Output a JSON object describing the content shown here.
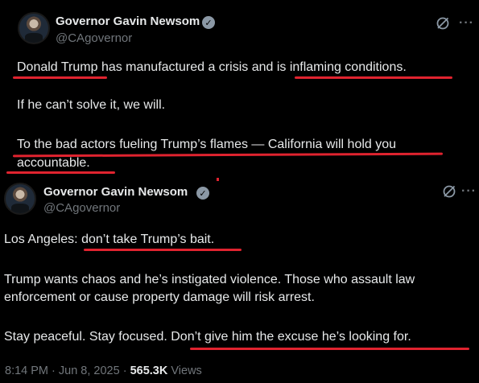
{
  "tweet1": {
    "author_name": "Governor Gavin Newsom",
    "handle": "@CAgovernor",
    "lines": [
      "Donald Trump has manufactured a crisis and is inflaming conditions.",
      "If he can’t solve it, we will.",
      "To the bad actors fueling Trump’s flames — California will hold you",
      "accountable."
    ]
  },
  "tweet2": {
    "author_name": "Governor Gavin Newsom",
    "handle": "@CAgovernor",
    "lines": [
      "Los Angeles: don’t take Trump’s bait.",
      "Trump wants chaos and he’s instigated violence. Those who assault law",
      "enforcement or cause property damage will risk arrest.",
      "Stay peaceful. Stay focused. Don’t give him the excuse he’s looking for."
    ],
    "meta": {
      "time": "8:14 PM",
      "date": "Jun 8, 2025",
      "views_count": "565.3K",
      "views_label": "Views"
    }
  },
  "colors": {
    "background": "#000000",
    "text": "#e7e9ea",
    "secondary_text": "#71767b",
    "underline_annotation": "#e0232f"
  },
  "icons": [
    "verified-badge-icon",
    "grok-icon",
    "more-options-icon",
    "avatar"
  ]
}
